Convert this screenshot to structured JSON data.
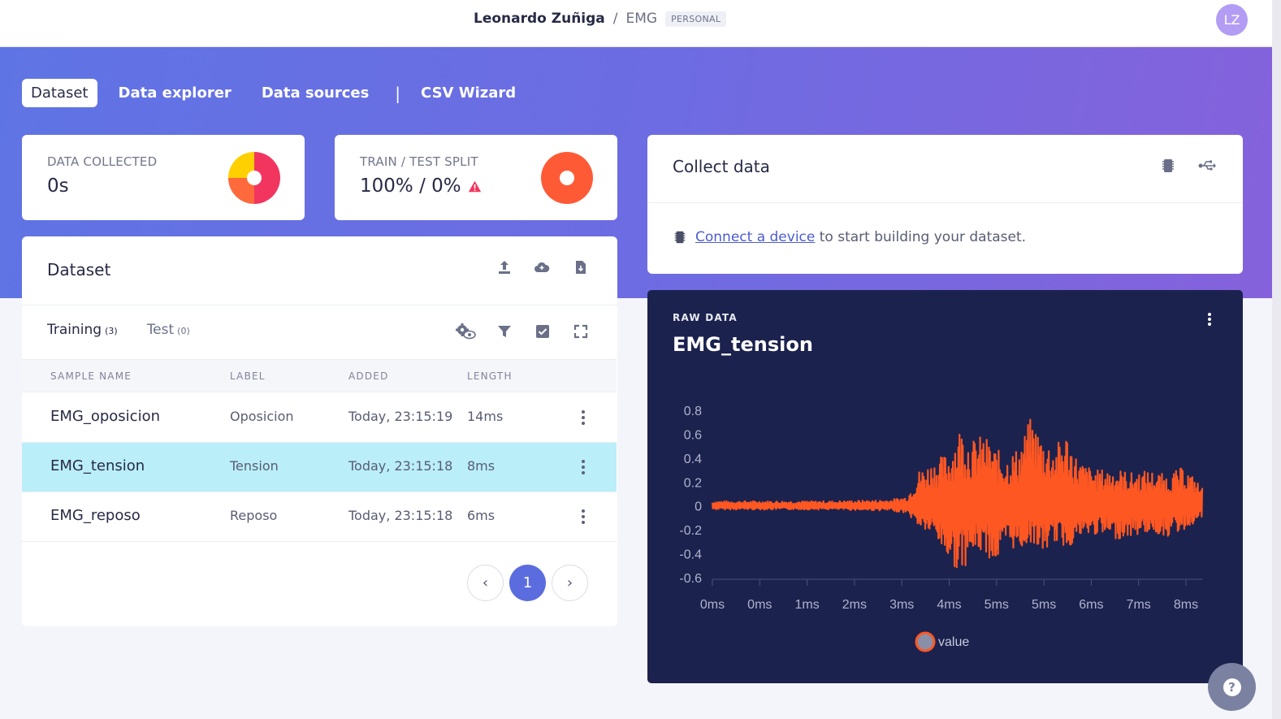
{
  "header": {
    "owner": "Leonardo Zuñiga",
    "separator": "/",
    "project": "EMG",
    "badge": "PERSONAL",
    "avatar_initials": "LZ"
  },
  "nav": {
    "tabs": [
      {
        "label": "Dataset",
        "active": true
      },
      {
        "label": "Data explorer",
        "active": false
      },
      {
        "label": "Data sources",
        "active": false
      },
      {
        "label": "CSV Wizard",
        "active": false
      }
    ],
    "divider": "|"
  },
  "stats": {
    "data_collected": {
      "label": "DATA COLLECTED",
      "value": "0s"
    },
    "split": {
      "label": "TRAIN / TEST SPLIT",
      "value": "100% / 0%",
      "warning_icon": "warning-icon"
    }
  },
  "dataset": {
    "title": "Dataset",
    "toolbar_icons": [
      "upload-icon",
      "cloud-upload-icon",
      "download-icon"
    ],
    "tabs": [
      {
        "label": "Training",
        "count": "(3)",
        "active": true
      },
      {
        "label": "Test",
        "count": "(0)",
        "active": false
      }
    ],
    "table_icons": [
      "settings-eye-icon",
      "filter-icon",
      "checkbox-icon",
      "expand-icon"
    ],
    "columns": [
      "SAMPLE NAME",
      "LABEL",
      "ADDED",
      "LENGTH"
    ],
    "rows": [
      {
        "name": "EMG_oposicion",
        "label": "Oposicion",
        "added": "Today, 23:15:19",
        "length": "14ms",
        "selected": false
      },
      {
        "name": "EMG_tension",
        "label": "Tension",
        "added": "Today, 23:15:18",
        "length": "8ms",
        "selected": true
      },
      {
        "name": "EMG_reposo",
        "label": "Reposo",
        "added": "Today, 23:15:18",
        "length": "6ms",
        "selected": false
      }
    ],
    "pagination": {
      "prev": "‹",
      "current": "1",
      "next": "›"
    }
  },
  "collect": {
    "title": "Collect data",
    "header_icons": [
      "chip-icon",
      "usb-icon"
    ],
    "link_text": "Connect a device",
    "message": "to start building your dataset."
  },
  "raw_data": {
    "label": "RAW DATA",
    "title": "EMG_tension",
    "legend": "value"
  },
  "chart_data": {
    "type": "line",
    "title": "EMG_tension",
    "series": [
      {
        "name": "value",
        "color": "#ff5722"
      }
    ],
    "y_ticks": [
      "0.8",
      "0.6",
      "0.4",
      "0.2",
      "0",
      "-0.2",
      "-0.4",
      "-0.6"
    ],
    "x_ticks": [
      "0ms",
      "0ms",
      "1ms",
      "2ms",
      "3ms",
      "4ms",
      "5ms",
      "5ms",
      "6ms",
      "7ms",
      "8ms"
    ],
    "ylim": [
      -0.6,
      0.8
    ],
    "xlim": [
      0,
      8.3
    ],
    "envelope": [
      {
        "x": 0.0,
        "min": -0.03,
        "max": 0.04
      },
      {
        "x": 1.0,
        "min": -0.03,
        "max": 0.04
      },
      {
        "x": 2.0,
        "min": -0.03,
        "max": 0.04
      },
      {
        "x": 3.0,
        "min": -0.04,
        "max": 0.05
      },
      {
        "x": 3.3,
        "min": -0.06,
        "max": 0.08
      },
      {
        "x": 3.5,
        "min": -0.18,
        "max": 0.3
      },
      {
        "x": 3.75,
        "min": -0.25,
        "max": 0.38
      },
      {
        "x": 4.0,
        "min": -0.46,
        "max": 0.45
      },
      {
        "x": 4.2,
        "min": -0.56,
        "max": 0.68
      },
      {
        "x": 4.4,
        "min": -0.42,
        "max": 0.55
      },
      {
        "x": 4.6,
        "min": -0.38,
        "max": 0.6
      },
      {
        "x": 4.8,
        "min": -0.5,
        "max": 0.48
      },
      {
        "x": 5.0,
        "min": -0.34,
        "max": 0.42
      },
      {
        "x": 5.2,
        "min": -0.38,
        "max": 0.5
      },
      {
        "x": 5.4,
        "min": -0.3,
        "max": 0.75
      },
      {
        "x": 5.6,
        "min": -0.4,
        "max": 0.58
      },
      {
        "x": 5.8,
        "min": -0.3,
        "max": 0.5
      },
      {
        "x": 6.0,
        "min": -0.36,
        "max": 0.62
      },
      {
        "x": 6.2,
        "min": -0.28,
        "max": 0.38
      },
      {
        "x": 6.5,
        "min": -0.24,
        "max": 0.3
      },
      {
        "x": 6.8,
        "min": -0.28,
        "max": 0.32
      },
      {
        "x": 7.1,
        "min": -0.26,
        "max": 0.28
      },
      {
        "x": 7.4,
        "min": -0.22,
        "max": 0.3
      },
      {
        "x": 7.7,
        "min": -0.26,
        "max": 0.26
      },
      {
        "x": 8.0,
        "min": -0.2,
        "max": 0.33
      },
      {
        "x": 8.3,
        "min": -0.1,
        "max": 0.16
      }
    ],
    "grid": false,
    "legend_position": "bottom"
  },
  "help": {
    "icon": "help-icon",
    "label": "?"
  }
}
